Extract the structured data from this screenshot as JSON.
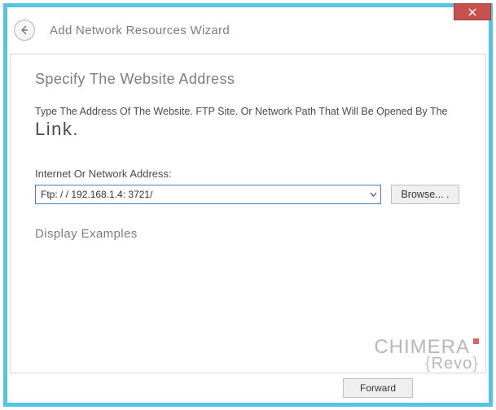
{
  "titlebar": {
    "close_icon": "×"
  },
  "header": {
    "wizard_title": "Add Network Resources Wizard"
  },
  "page": {
    "heading": "Specify The Website Address",
    "instruction_line1": "Type The Address Of The Website. FTP Site. Or Network Path That Will Be Opened By The",
    "instruction_line2": "Link.",
    "field_label": "Internet Or Network Address:",
    "address_value": "Ftp: / / 192.168.1.4: 3721/",
    "browse_label": "Browse... .",
    "examples_link": "Display Examples"
  },
  "footer": {
    "forward_label": "Forward"
  },
  "watermark": {
    "line1": "CHIMERA",
    "line2": "Revo"
  }
}
